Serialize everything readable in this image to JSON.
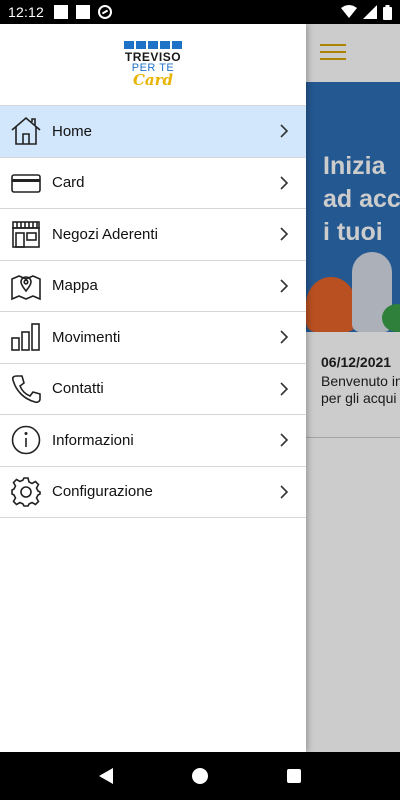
{
  "status_bar": {
    "time": "12:12"
  },
  "drawer": {
    "logo": {
      "line1": "TREVISO",
      "line2": "PER TE",
      "line3": "Card"
    },
    "items": [
      {
        "label": "Home",
        "icon": "home-icon",
        "active": true
      },
      {
        "label": "Card",
        "icon": "card-icon"
      },
      {
        "label": "Negozi Aderenti",
        "icon": "store-icon"
      },
      {
        "label": "Mappa",
        "icon": "map-icon"
      },
      {
        "label": "Movimenti",
        "icon": "bar-chart-icon"
      },
      {
        "label": "Contatti",
        "icon": "phone-icon"
      },
      {
        "label": "Informazioni",
        "icon": "info-icon"
      },
      {
        "label": "Configurazione",
        "icon": "gear-icon"
      }
    ]
  },
  "main": {
    "hero_lines": [
      "Inizia",
      "ad acc",
      "i tuoi"
    ],
    "news": {
      "date": "06/12/2021",
      "line1": "Benvenuto in",
      "line2": "per gli acqui"
    }
  },
  "colors": {
    "accent": "#d9a400",
    "hero": "#2d6fb6",
    "active_item": "#d2e7fb",
    "brand_blue": "#1f73c7"
  }
}
